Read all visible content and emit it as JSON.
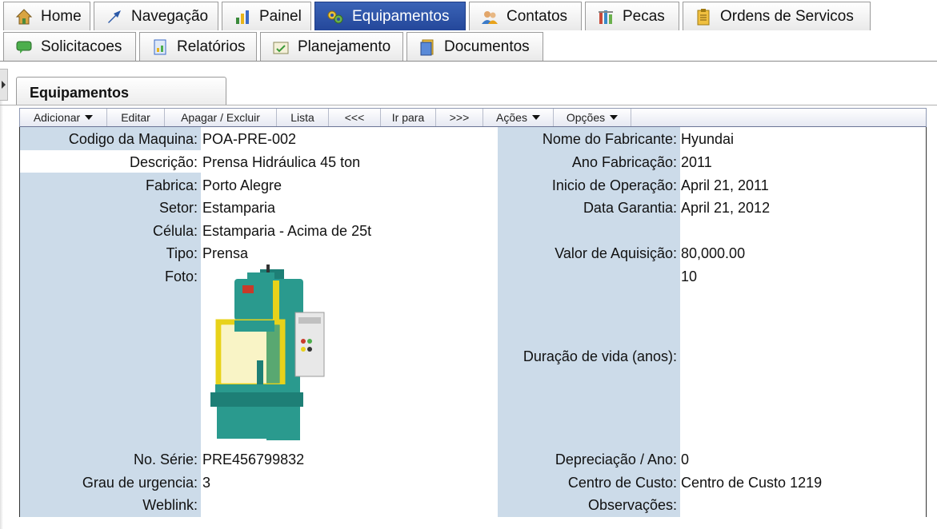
{
  "nav": {
    "row1": [
      {
        "label": "Home",
        "icon": "home-icon",
        "active": false
      },
      {
        "label": "Navegação",
        "icon": "arrow-icon",
        "active": false
      },
      {
        "label": "Painel",
        "icon": "bar-chart-icon",
        "active": false
      },
      {
        "label": "Equipamentos",
        "icon": "gears-icon",
        "active": true
      },
      {
        "label": "Contatos",
        "icon": "people-icon",
        "active": false
      },
      {
        "label": "Pecas",
        "icon": "parts-icon",
        "active": false
      },
      {
        "label": "Ordens de Servicos",
        "icon": "clipboard-icon",
        "active": false
      }
    ],
    "row2": [
      {
        "label": "Solicitacoes",
        "icon": "speech-bubble-icon",
        "active": false
      },
      {
        "label": "Relatórios",
        "icon": "report-icon",
        "active": false
      },
      {
        "label": "Planejamento",
        "icon": "calendar-icon",
        "active": false
      },
      {
        "label": "Documentos",
        "icon": "document-icon",
        "active": false
      }
    ]
  },
  "panel": {
    "title": "Equipamentos"
  },
  "toolbar": {
    "add": "Adicionar",
    "edit": "Editar",
    "delete": "Apagar / Excluir",
    "list": "Lista",
    "prev": "<<<",
    "goto": "Ir para",
    "next": ">>>",
    "actions": "Ações",
    "options": "Opções"
  },
  "fields": {
    "codigo": {
      "label": "Codigo da Maquina:",
      "value": "POA-PRE-002"
    },
    "descricao": {
      "label": "Descrição:",
      "value": "Prensa Hidráulica 45 ton"
    },
    "fabrica": {
      "label": "Fabrica:",
      "value": "Porto Alegre"
    },
    "setor": {
      "label": "Setor:",
      "value": "Estamparia"
    },
    "celula": {
      "label": "Célula:",
      "value": "Estamparia - Acima de 25t"
    },
    "tipo": {
      "label": "Tipo:",
      "value": "Prensa"
    },
    "foto": {
      "label": "Foto:"
    },
    "serie": {
      "label": "No. Série:",
      "value": "PRE456799832"
    },
    "urgencia": {
      "label": "Grau de urgencia:",
      "value": "3"
    },
    "weblink": {
      "label": "Weblink:",
      "value": ""
    },
    "fabricante": {
      "label": "Nome do Fabricante:",
      "value": "Hyundai"
    },
    "ano": {
      "label": "Ano Fabricação:",
      "value": "2011"
    },
    "inicio": {
      "label": "Inicio de Operação:",
      "value": "April 21, 2011"
    },
    "garantia": {
      "label": "Data Garantia:",
      "value": "April 21, 2012"
    },
    "aquisicao": {
      "label": "Valor de Aquisição:",
      "value": "80,000.00"
    },
    "vida": {
      "label": "Duração de vida (anos):",
      "value": "10"
    },
    "depreciacao": {
      "label": "Depreciação / Ano:",
      "value": "0"
    },
    "custo": {
      "label": "Centro de Custo:",
      "value": "Centro de Custo 1219"
    },
    "observacoes": {
      "label": "Observações:",
      "value": ""
    }
  },
  "colors": {
    "active_tab": "#2b4ea3",
    "label_column": "#ccdbe9",
    "machine_body": "#2a9a8e",
    "machine_guard": "#e8d21a"
  }
}
